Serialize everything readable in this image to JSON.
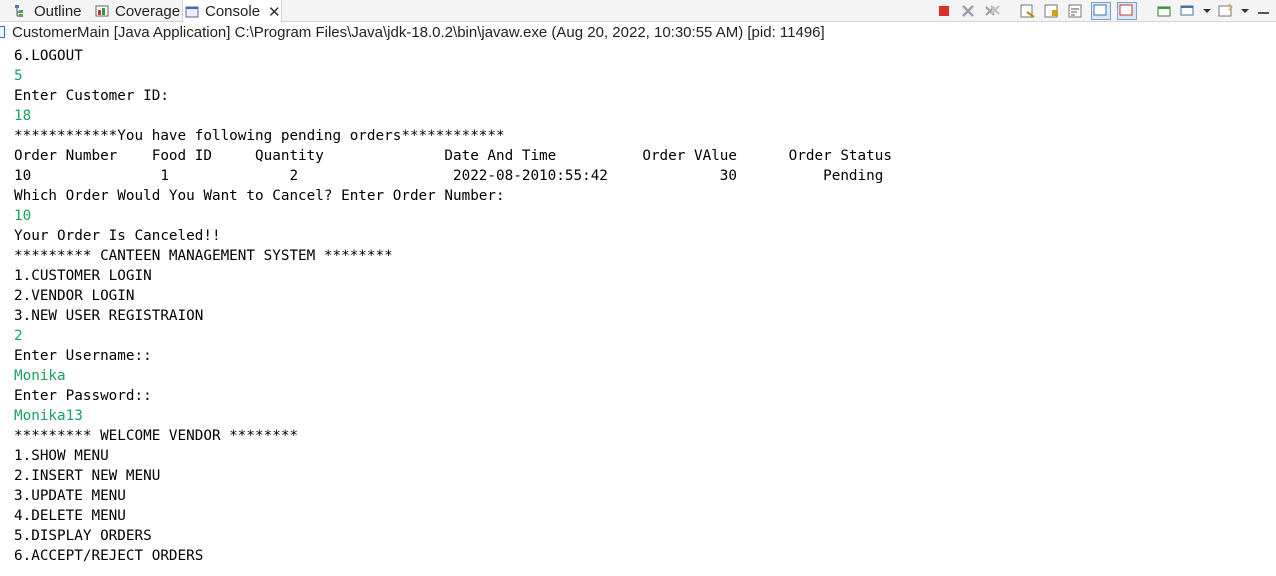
{
  "tabs": [
    {
      "label": "Outline",
      "icon": "outline-icon"
    },
    {
      "label": "Coverage",
      "icon": "coverage-icon"
    },
    {
      "label": "Console",
      "icon": "console-icon",
      "active": true
    }
  ],
  "launch_info": "CustomerMain [Java Application] C:\\Program Files\\Java\\jdk-18.0.2\\bin\\javaw.exe  (Aug 20, 2022, 10:30:55 AM) [pid: 11496]",
  "colors": {
    "input_text": "#1aa260",
    "terminate": "#d93025"
  },
  "console_lines": [
    {
      "text": "6.LOGOUT",
      "type": "output"
    },
    {
      "text": "5",
      "type": "input"
    },
    {
      "text": "Enter Customer ID:",
      "type": "output"
    },
    {
      "text": "18",
      "type": "input"
    },
    {
      "text": "************You have following pending orders************",
      "type": "output"
    },
    {
      "text": "Order Number    Food ID     Quantity              Date And Time          Order VAlue      Order Status",
      "type": "output"
    },
    {
      "text": "10               1              2                  2022-08-2010:55:42             30          Pending",
      "type": "output"
    },
    {
      "text": "Which Order Would You Want to Cancel? Enter Order Number:",
      "type": "output"
    },
    {
      "text": "10",
      "type": "input"
    },
    {
      "text": "Your Order Is Canceled!!",
      "type": "output"
    },
    {
      "text": "********* CANTEEN MANAGEMENT SYSTEM ********",
      "type": "output"
    },
    {
      "text": "1.CUSTOMER LOGIN",
      "type": "output"
    },
    {
      "text": "2.VENDOR LOGIN",
      "type": "output"
    },
    {
      "text": "3.NEW USER REGISTRAION",
      "type": "output"
    },
    {
      "text": "2",
      "type": "input"
    },
    {
      "text": "Enter Username::",
      "type": "output"
    },
    {
      "text": "Monika",
      "type": "input"
    },
    {
      "text": "Enter Password::",
      "type": "output"
    },
    {
      "text": "Monika13",
      "type": "input"
    },
    {
      "text": "********* WELCOME VENDOR ********",
      "type": "output"
    },
    {
      "text": "1.SHOW MENU",
      "type": "output"
    },
    {
      "text": "2.INSERT NEW MENU",
      "type": "output"
    },
    {
      "text": "3.UPDATE MENU",
      "type": "output"
    },
    {
      "text": "4.DELETE MENU",
      "type": "output"
    },
    {
      "text": "5.DISPLAY ORDERS",
      "type": "output"
    },
    {
      "text": "6.ACCEPT/REJECT ORDERS",
      "type": "output"
    }
  ]
}
